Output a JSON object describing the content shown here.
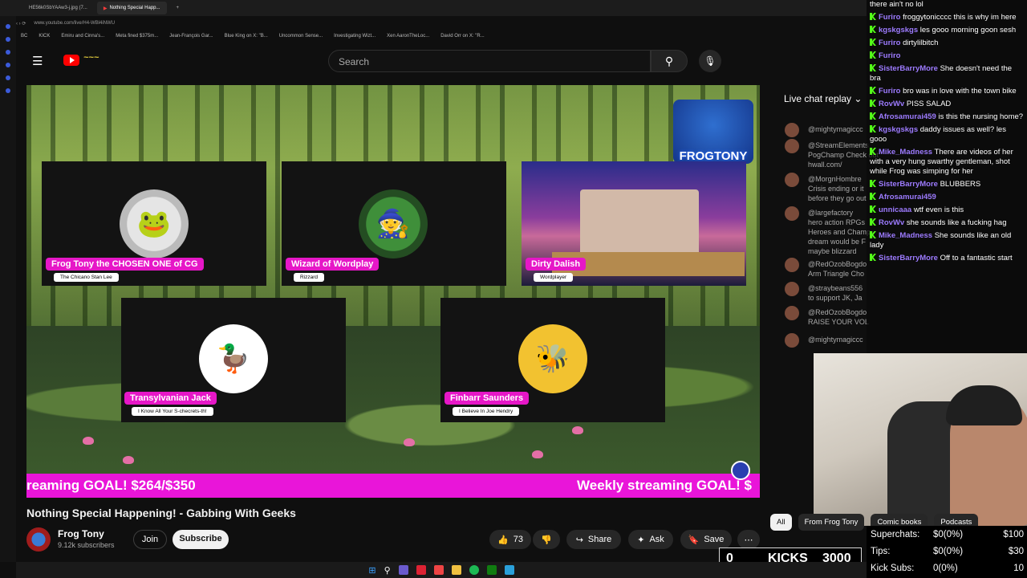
{
  "browser": {
    "tabs": [
      "HE56k0SbYAAw3-j.jpg (7...",
      "Nothing Special Happ..."
    ],
    "url": "www.youtube.com/live/H4-WBl4iNWU",
    "bookmarks": [
      "BC",
      "KICK",
      "Emiru and Cinna's...",
      "Meta fined $375m...",
      "Jean-François Gar...",
      "Blue King on X: \"B...",
      "Uncommon Sense...",
      "Investigating Wizt...",
      "Xen AaronTheLoc...",
      "David Orr on X: \"R..."
    ]
  },
  "header": {
    "search_placeholder": "Search"
  },
  "video": {
    "title": "Nothing Special Happening! - Gabbing With Geeks",
    "logo_text": "FROGTONY",
    "ticker_left": "reaming GOAL! $264/$350",
    "ticker_right": "Weekly streaming GOAL! $",
    "panels": [
      {
        "name": "Frog Tony the CHOSEN ONE of CG",
        "sub": "The Chicano Stan Lee"
      },
      {
        "name": "Wizard of Wordplay",
        "sub": "Rizzard"
      },
      {
        "name": "Dirty Dalish",
        "sub": "Wordplayer"
      },
      {
        "name": "Transylvanian Jack",
        "sub": "I Know All Your S-checrets-th!"
      },
      {
        "name": "Finbarr Saunders",
        "sub": "I Believe In Joe Hendry"
      }
    ]
  },
  "channel": {
    "name": "Frog Tony",
    "subs": "9.12k subscribers",
    "join": "Join",
    "subscribe": "Subscribe"
  },
  "actions": {
    "likes": "73",
    "share": "Share",
    "ask": "Ask",
    "save": "Save"
  },
  "livechat": {
    "header": "Live chat replay",
    "rows": [
      "@mightymagiccc",
      "@StreamElements",
      "PogChamp Check out",
      "hwall.com/",
      "@MorgnHombre",
      "Crisis ending or it",
      "before they go out",
      "@largefactory",
      "hero action RPGs",
      "Heroes and Champ",
      "dream would be F",
      "maybe blizzard",
      "@RedOzobBogdo",
      "Arm Triangle Cho",
      "@straybeans556",
      "to support JK, Ja",
      "@RedOzobBogdo",
      "RAISE YOUR VOL",
      "@mightymagiccc"
    ]
  },
  "overlay_chat": [
    {
      "user": "",
      "text": "there ain't no lol",
      "color": "#ffffff"
    },
    {
      "user": "Furiro",
      "text": "froggytonicccc this is why im here",
      "color": "#9d7bff"
    },
    {
      "user": "kgskgskgs",
      "text": "les gooo morning goon sesh",
      "color": "#9d7bff"
    },
    {
      "user": "Furiro",
      "text": "dirtylilbitch",
      "color": "#9d7bff"
    },
    {
      "user": "Furiro",
      "text": "",
      "color": "#9d7bff"
    },
    {
      "user": "SisterBarryMore",
      "text": "She doesn't need the bra",
      "color": "#9d7bff"
    },
    {
      "user": "Furiro",
      "text": "bro was in love with the town bike",
      "color": "#9d7bff"
    },
    {
      "user": "RovWv",
      "text": "PISS SALAD",
      "color": "#9d7bff"
    },
    {
      "user": "Afrosamurai459",
      "text": "is this the nursing home?",
      "color": "#9d7bff"
    },
    {
      "user": "kgskgskgs",
      "text": "daddy issues as well? les gooo",
      "color": "#9d7bff"
    },
    {
      "user": "Mike_Madness",
      "text": "There are videos of her with a very hung swarthy gentleman, shot while Frog was simping for her",
      "color": "#9d7bff"
    },
    {
      "user": "SisterBarryMore",
      "text": "BLUBBERS",
      "color": "#9d7bff"
    },
    {
      "user": "Afrosamurai459",
      "text": "",
      "color": "#9d7bff"
    },
    {
      "user": "unnicaaa",
      "text": "wtf even is this",
      "color": "#9d7bff"
    },
    {
      "user": "RovWv",
      "text": "she sounds like a fucking hag",
      "color": "#9d7bff"
    },
    {
      "user": "Mike_Madness",
      "text": "She sounds like an old lady",
      "color": "#9d7bff"
    },
    {
      "user": "SisterBarryMore",
      "text": "Off to a fantastic start",
      "color": "#9d7bff"
    }
  ],
  "chips": [
    "All",
    "From Frog Tony",
    "Comic books",
    "Podcasts"
  ],
  "stats": [
    {
      "label": "Superchats:",
      "value": "$0(0%)",
      "goal": "$100"
    },
    {
      "label": "Tips:",
      "value": "$0(0%)",
      "goal": "$30"
    },
    {
      "label": "Kick Subs:",
      "value": "0(0%)",
      "goal": "10"
    }
  ],
  "kicks": {
    "count": "0",
    "label": "KICKS",
    "goal": "3000"
  }
}
